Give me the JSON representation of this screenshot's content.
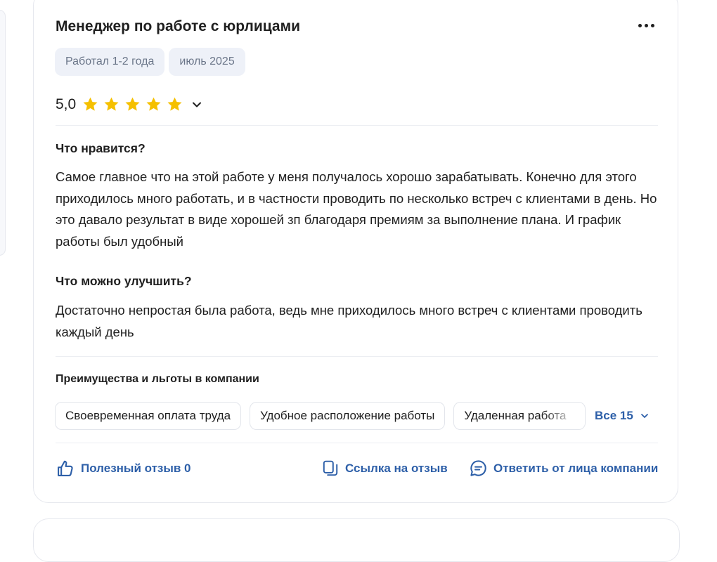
{
  "review": {
    "title": "Менеджер по работе с юрлицами",
    "tags": [
      "Работал 1-2 года",
      "июль 2025"
    ],
    "rating_value": "5,0",
    "rating_stars": 5,
    "likes_heading": "Что нравится?",
    "likes_text": "Самое главное что на этой работе у меня получалось хорошо зарабатывать. Конечно для этого приходилось много работать, и в частности проводить по несколько встреч с клиентами в день. Но это давало результат в виде хорошей зп благодаря премиям за выполнение плана. И график работы был удобный",
    "improve_heading": "Что можно улучшить?",
    "improve_text": "Достаточно непростая была работа, ведь мне приходилось много встреч с клиентами проводить каждый день"
  },
  "benefits": {
    "title": "Преимущества и льготы в компании",
    "items": [
      "Своевременная оплата труда",
      "Удобное расположение работы",
      "Удаленная работа"
    ],
    "all_label": "Все 15"
  },
  "actions": {
    "helpful": "Полезный отзыв 0",
    "link": "Ссылка на отзыв",
    "reply": "Ответить от лица компании"
  },
  "colors": {
    "star": "#f5c000",
    "accent": "#2d5fa8",
    "chip_bg": "#eef1f8"
  },
  "icons": [
    "more-icon",
    "star-icon",
    "chevron-down-icon",
    "thumbs-up-icon",
    "copy-link-icon",
    "chat-bubble-icon"
  ]
}
